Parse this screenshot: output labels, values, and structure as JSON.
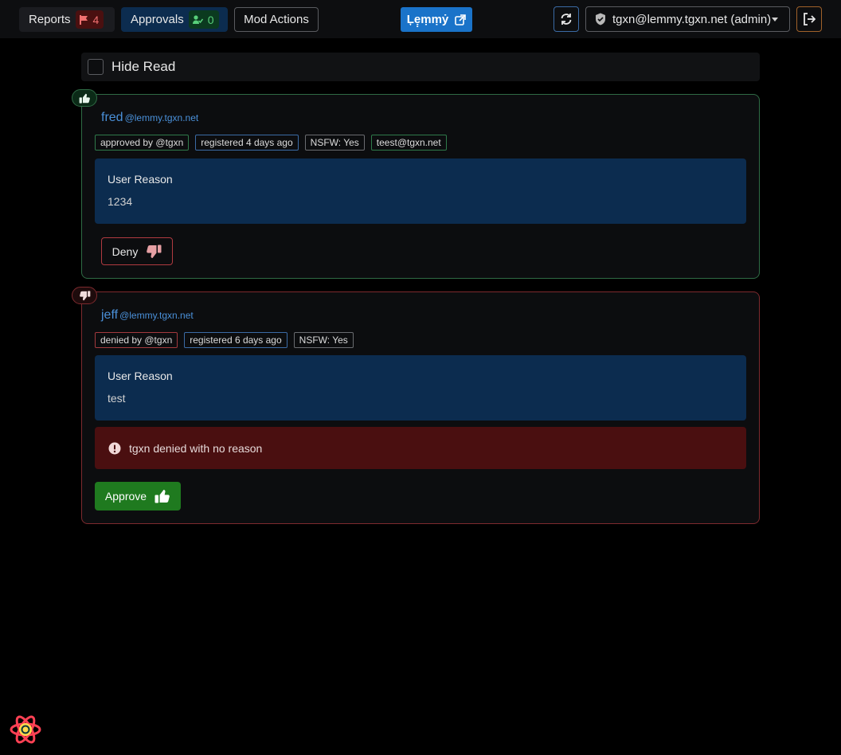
{
  "nav": {
    "reports_label": "Reports",
    "reports_count": "4",
    "approvals_label": "Approvals",
    "approvals_count": "0",
    "mod_actions_label": "Mod Actions",
    "lemmy_label": "Ļẹ̣ṃṃẏ",
    "refresh_icon": "refresh-icon",
    "user_label": "tgxn@lemmy.tgxn.net (admin)",
    "logout_icon": "logout-icon"
  },
  "filter": {
    "hide_read_label": "Hide Read",
    "hide_read_checked": false
  },
  "applications": [
    {
      "status": "approved",
      "username": "fred",
      "instance": "@lemmy.tgxn.net",
      "tags": [
        "approved by @tgxn",
        "registered 4 days ago",
        "NSFW: Yes",
        "teest@tgxn.net"
      ],
      "reason_title": "User Reason",
      "reason_text": "1234",
      "action_label": "Deny"
    },
    {
      "status": "denied",
      "username": "jeff",
      "instance": "@lemmy.tgxn.net",
      "tags": [
        "denied by @tgxn",
        "registered 6 days ago",
        "NSFW: Yes"
      ],
      "reason_title": "User Reason",
      "reason_text": "test",
      "alert_text": "tgxn denied with no reason",
      "action_label": "Approve"
    }
  ],
  "colors": {
    "accent": "#1a73c9",
    "approved": "#2f6b45",
    "denied": "#7e2a2e",
    "reason_bg": "#0c2c4f"
  }
}
